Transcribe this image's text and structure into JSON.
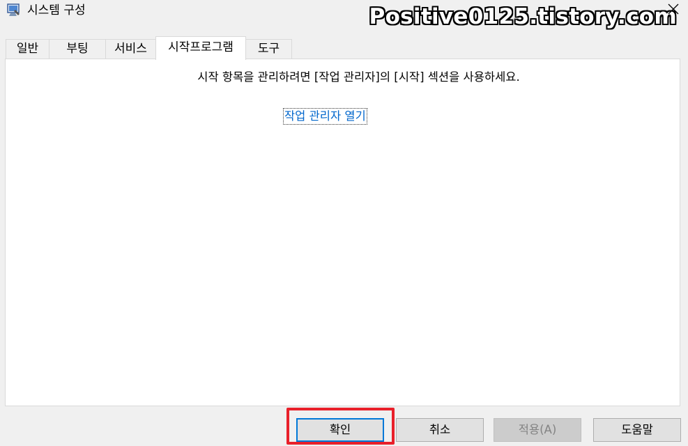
{
  "window": {
    "title": "시스템 구성",
    "watermark": "Positive0125.tistory.com",
    "close_glyph": "✕"
  },
  "tabs": [
    {
      "label": "일반",
      "active": false
    },
    {
      "label": "부팅",
      "active": false
    },
    {
      "label": "서비스",
      "active": false
    },
    {
      "label": "시작프로그램",
      "active": true
    },
    {
      "label": "도구",
      "active": false
    }
  ],
  "startup": {
    "message": "시작 항목을 관리하려면 [작업 관리자]의 [시작] 섹션을 사용하세요.",
    "link": "작업 관리자 열기"
  },
  "buttons": {
    "ok": "확인",
    "cancel": "취소",
    "apply": "적용(A)",
    "help": "도움말"
  },
  "colors": {
    "highlight": "#e8202a",
    "link": "#0066cc",
    "default_button_border": "#0078d7"
  }
}
